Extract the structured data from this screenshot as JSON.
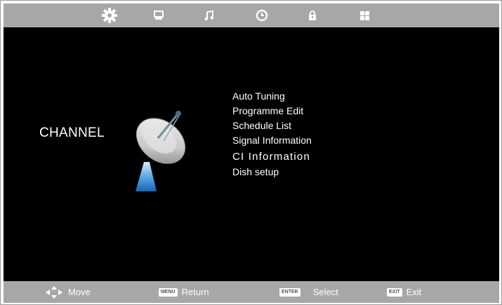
{
  "top_tabs": [
    {
      "icon": "gear-icon",
      "selected": true
    },
    {
      "icon": "monitor-icon",
      "selected": false
    },
    {
      "icon": "music-note-icon",
      "selected": false
    },
    {
      "icon": "clock-icon",
      "selected": false
    },
    {
      "icon": "lock-icon",
      "selected": false
    },
    {
      "icon": "grid-icon",
      "selected": false
    }
  ],
  "category": {
    "title": "CHANNEL",
    "icon": "satellite-dish-icon"
  },
  "menu": {
    "items": [
      "Auto Tuning",
      "Programme Edit",
      "Schedule List",
      "Signal Information",
      "CI Information",
      "Dish setup"
    ]
  },
  "footer": {
    "move": {
      "icon": "dpad-arrows-icon",
      "label": "Move"
    },
    "return": {
      "key": "MENU",
      "label": "Return"
    },
    "select": {
      "key": "ENTER",
      "label": "Select"
    },
    "exit": {
      "key": "EXIT",
      "label": "Exit"
    }
  },
  "colors": {
    "bar": "#a7a7a7",
    "background": "#000000",
    "text": "#ffffff"
  }
}
